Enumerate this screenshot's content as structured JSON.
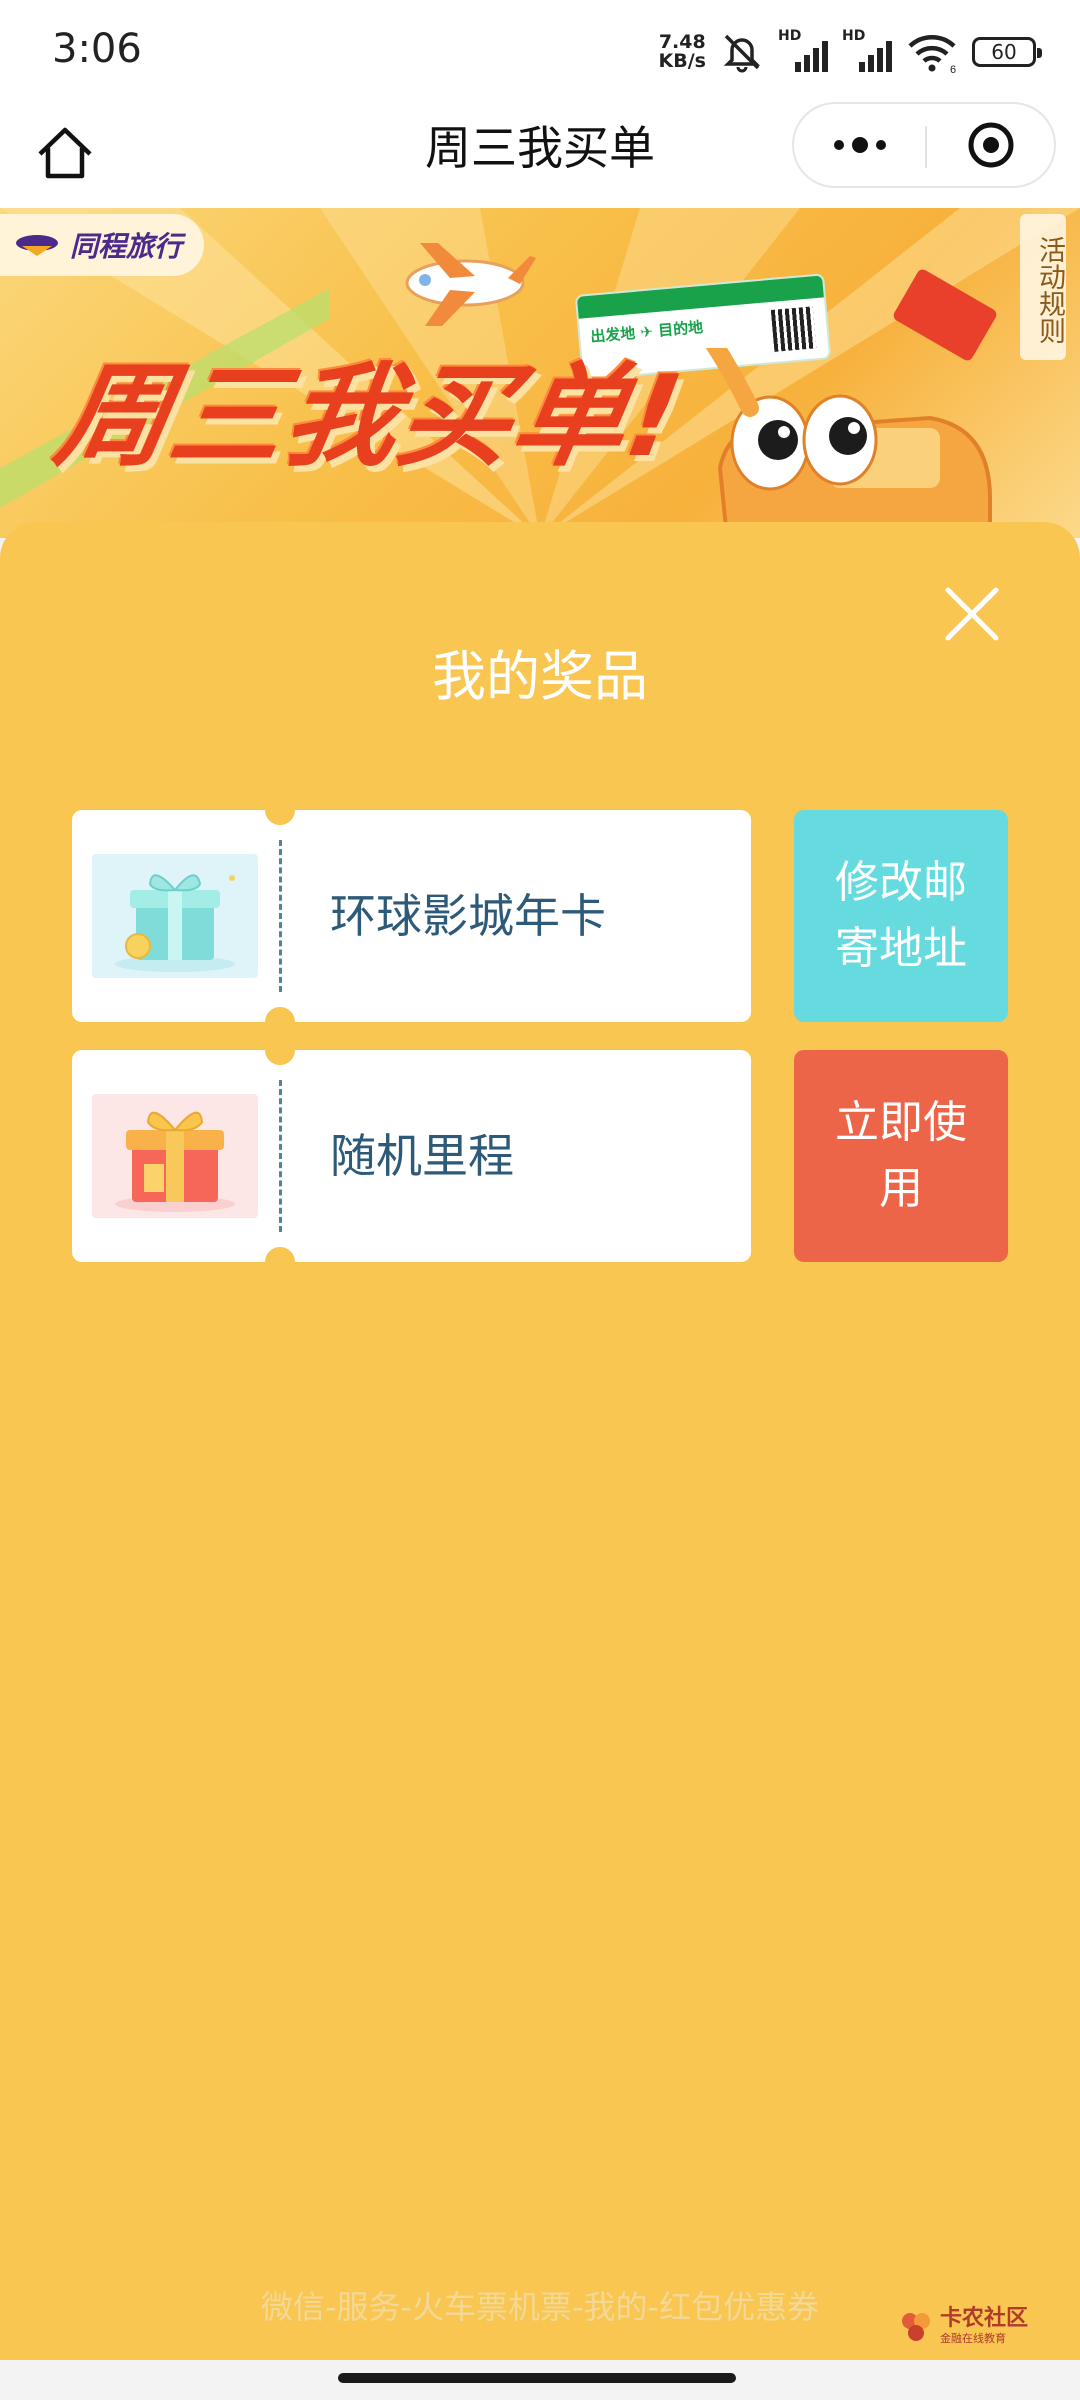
{
  "status_bar": {
    "time": "3:06",
    "net_speed_value": "7.48",
    "net_speed_unit": "KB/s",
    "signal_label": "HD",
    "wifi_label": "6",
    "battery": "60"
  },
  "nav": {
    "title": "周三我买单",
    "home_icon": "home-icon",
    "more_icon": "more-icon",
    "close_icon": "target-icon"
  },
  "banner": {
    "brand": "同程旅行",
    "headline": "周三我买单!",
    "rules_tab": "活动规则",
    "ticket_route": "出发地 ✈ 目的地"
  },
  "prizes_sheet": {
    "title": "我的奖品",
    "items": [
      {
        "name": "环球影城年卡",
        "action": "修改邮寄地址",
        "action_color": "#65dbe0",
        "icon": "gift-teal-icon"
      },
      {
        "name": "随机里程",
        "action": "立即使用",
        "action_color": "#ec6549",
        "icon": "gift-red-icon"
      }
    ],
    "footer_hint": "微信-服务-火车票机票-我的-红包优惠券"
  },
  "watermark": {
    "name": "卡农社区",
    "sub": "金融在线教育"
  },
  "colors": {
    "sheet_background": "#f8c651",
    "prize_text": "#2d5a78"
  }
}
